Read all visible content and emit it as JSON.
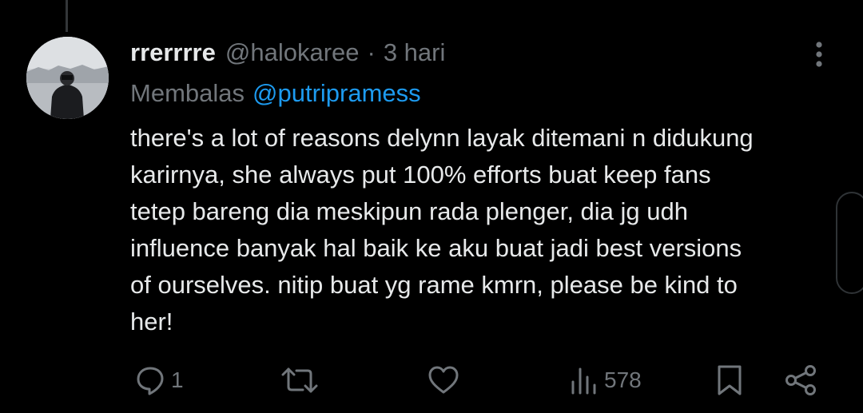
{
  "tweet": {
    "author": {
      "display_name": "rrerrrre",
      "handle": "@halokaree"
    },
    "separator": "·",
    "time": "3 hari",
    "reply_prefix": "Membalas",
    "reply_to": "@putripramess",
    "text_lines": [
      "there's a lot of reasons delynn layak ditemani n didukung",
      "karirnya, she always put 100% efforts buat keep fans",
      "tetep bareng dia meskipun rada plenger, dia jg udh",
      "influence banyak hal baik ke aku buat jadi best versions",
      "of ourselves. nitip buat yg rame kmrn, please be kind to",
      "her!"
    ],
    "stats": {
      "replies": "1",
      "views": "578"
    }
  },
  "icons": {
    "more": "more-vertical-icon",
    "reply": "reply-icon",
    "retweet": "retweet-icon",
    "like": "heart-icon",
    "views": "views-chart-icon",
    "bookmark": "bookmark-icon",
    "share": "share-icon"
  },
  "colors": {
    "background": "#000000",
    "text": "#e7e9ea",
    "secondary": "#71767b",
    "accent": "#1d9bf0",
    "border": "#2f3336"
  }
}
